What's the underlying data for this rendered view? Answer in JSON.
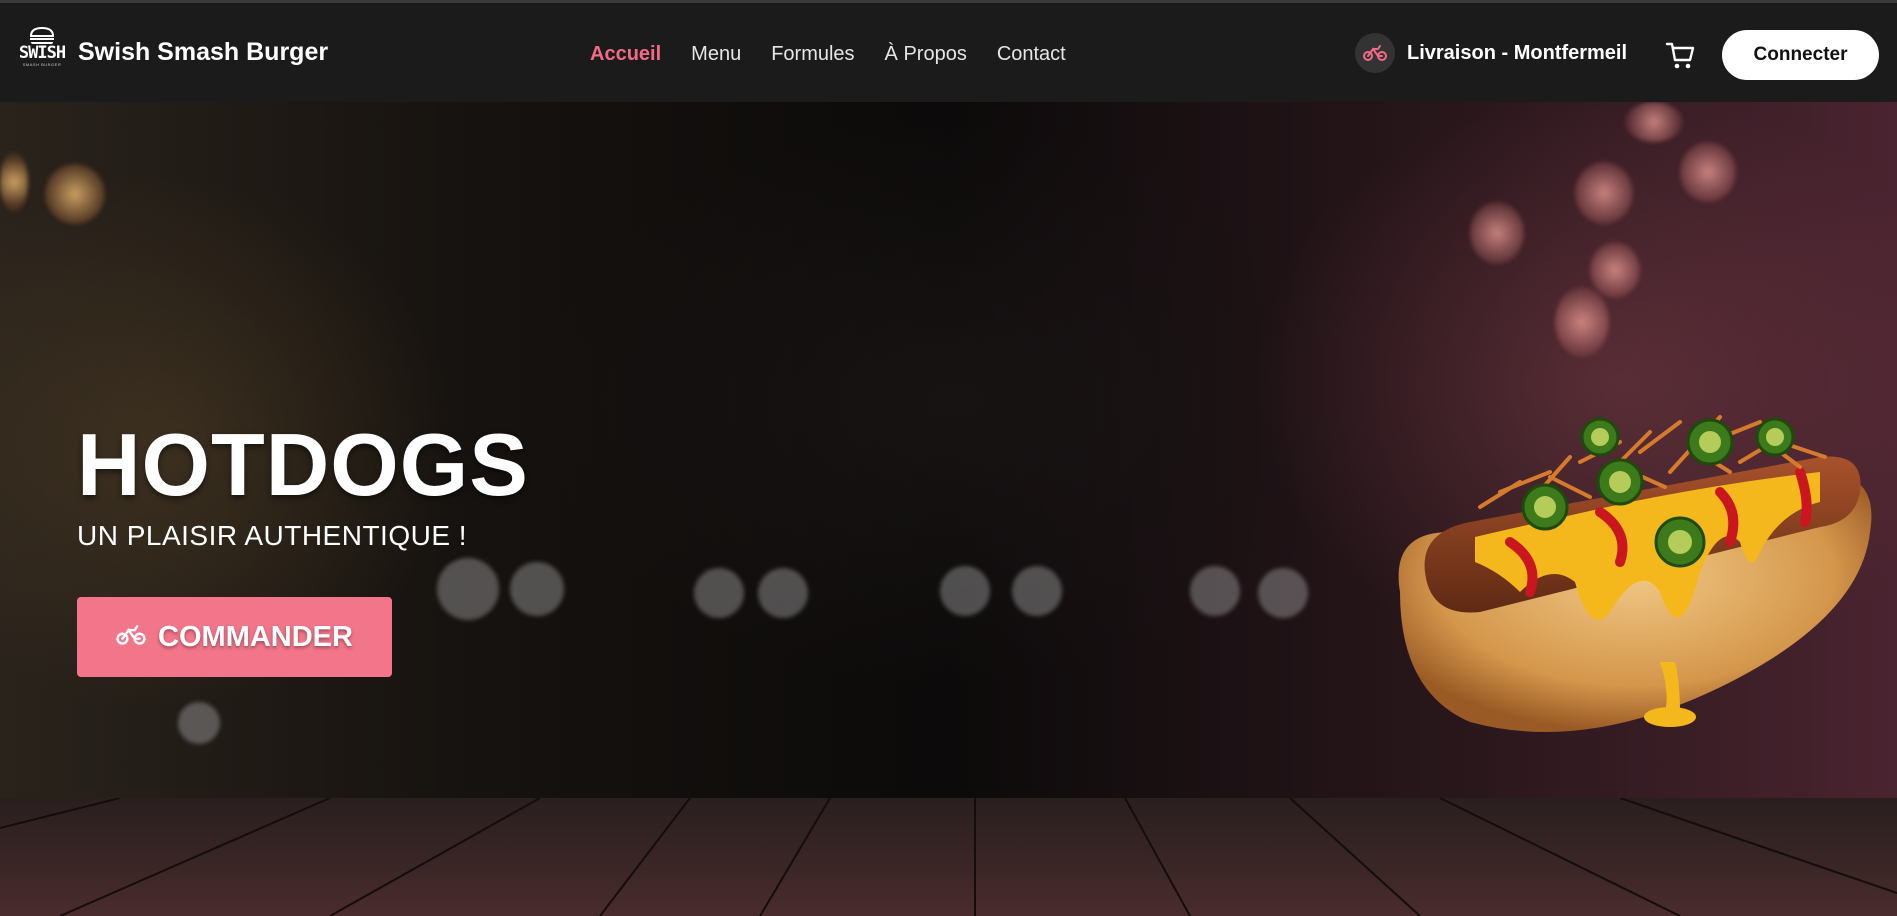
{
  "header": {
    "logo_word": "SWISH",
    "logo_sub": "SMASH BURGER",
    "brand_name": "Swish Smash Burger",
    "nav": [
      {
        "label": "Accueil",
        "active": true
      },
      {
        "label": "Menu",
        "active": false
      },
      {
        "label": "Formules",
        "active": false
      },
      {
        "label": "À Propos",
        "active": false
      },
      {
        "label": "Contact",
        "active": false
      }
    ],
    "delivery_label": "Livraison - Montfermeil",
    "delivery_icon": "bicycle-icon",
    "cart_icon": "cart-icon",
    "login_label": "Connecter"
  },
  "hero": {
    "title": "HOTDOGS",
    "subtitle": "UN PLAISIR AUTHENTIQUE !",
    "cta_label": "COMMANDER",
    "cta_icon": "bicycle-icon",
    "image_subject": "hotdog"
  },
  "colors": {
    "accent": "#f26a85",
    "button": "#f27589",
    "header_bg": "#1b1b1b"
  }
}
